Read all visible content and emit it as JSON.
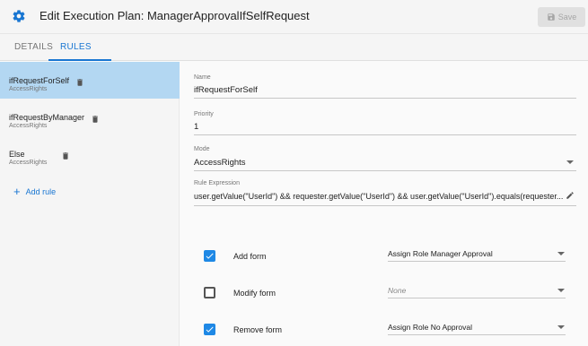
{
  "header": {
    "title": "Edit Execution Plan: ManagerApprovalIfSelfRequest",
    "save_label": "Save"
  },
  "tabs": [
    {
      "label": "DETAILS",
      "active": false
    },
    {
      "label": "RULES",
      "active": true
    }
  ],
  "sidebar": {
    "rules": [
      {
        "name": "ifRequestForSelf",
        "type": "AccessRights",
        "selected": true
      },
      {
        "name": "ifRequestByManager",
        "type": "AccessRights",
        "selected": false
      },
      {
        "name": "Else",
        "type": "AccessRights",
        "selected": false
      }
    ],
    "add_rule_label": "Add rule"
  },
  "form": {
    "name_label": "Name",
    "name_value": "ifRequestForSelf",
    "priority_label": "Priority",
    "priority_value": "1",
    "mode_label": "Mode",
    "mode_value": "AccessRights",
    "expression_label": "Rule Expression",
    "expression_value": "user.getValue(\"UserId\") && requester.getValue(\"UserId\") && user.getValue(\"UserId\").equals(requester..."
  },
  "forms": [
    {
      "label": "Add form",
      "checked": true,
      "value": "Assign Role Manager Approval"
    },
    {
      "label": "Modify form",
      "checked": false,
      "value": "None"
    },
    {
      "label": "Remove form",
      "checked": true,
      "value": "Assign Role No Approval"
    }
  ],
  "colors": {
    "accent": "#1976d2",
    "selected_row": "#b3d7f2",
    "checkbox_on": "#1e88e5"
  },
  "icons": {
    "header": "gear-icon",
    "save": "floppy-disk-icon",
    "rule_delete": "trash-icon",
    "add": "plus-icon",
    "edit": "pencil-icon",
    "select": "chevron-down-icon"
  }
}
